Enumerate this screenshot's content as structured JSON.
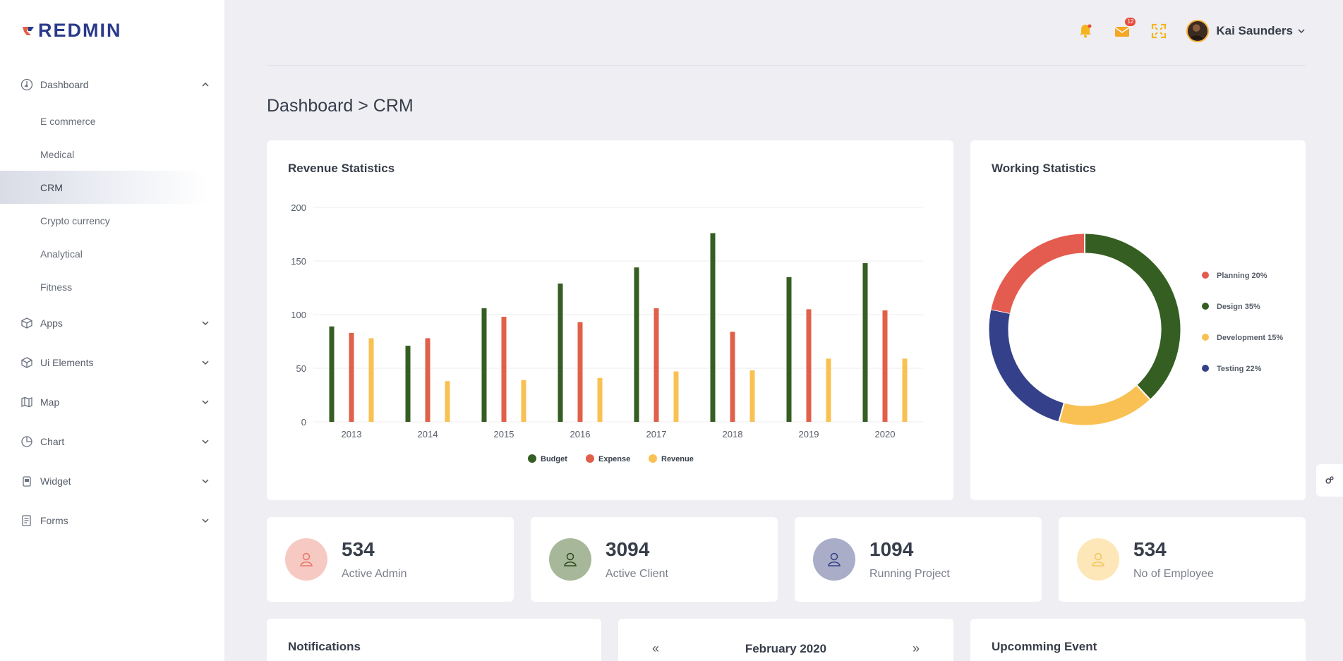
{
  "brand": {
    "name": "REDMIN"
  },
  "sidebar": {
    "dashboard": {
      "label": "Dashboard",
      "icon": "dashboard-icon"
    },
    "sub_items": [
      {
        "label": "E commerce"
      },
      {
        "label": "Medical"
      },
      {
        "label": "CRM",
        "active": true
      },
      {
        "label": "Crypto currency"
      },
      {
        "label": "Analytical"
      },
      {
        "label": "Fitness"
      }
    ],
    "items": [
      {
        "label": "Apps",
        "icon": "box-icon"
      },
      {
        "label": "Ui Elements",
        "icon": "cube-icon"
      },
      {
        "label": "Map",
        "icon": "map-icon"
      },
      {
        "label": "Chart",
        "icon": "pie-chart-icon"
      },
      {
        "label": "Widget",
        "icon": "widget-icon"
      },
      {
        "label": "Forms",
        "icon": "form-icon"
      }
    ]
  },
  "topbar": {
    "mail_badge": "12",
    "user_name": "Kai Saunders"
  },
  "page_title": "Dashboard > CRM",
  "revenue_card": {
    "title": "Revenue Statistics"
  },
  "working_card": {
    "title": "Working Statistics"
  },
  "stats": [
    {
      "value": "534",
      "label": "Active Admin",
      "color": "#e8766a",
      "bg": "#f7c9c3"
    },
    {
      "value": "3094",
      "label": "Active Client",
      "color": "#3d5a2a",
      "bg": "#a7b89a"
    },
    {
      "value": "1094",
      "label": "Running Project",
      "color": "#34418a",
      "bg": "#a9adc8"
    },
    {
      "value": "534",
      "label": "No of Employee",
      "color": "#f5c55c",
      "bg": "#fde7b8"
    }
  ],
  "bottom": {
    "notifications_title": "Notifications",
    "calendar_month": "February 2020",
    "calendar_prev": "«",
    "calendar_next": "»",
    "events_title": "Upcomming Event"
  },
  "chart_data": [
    {
      "type": "bar",
      "title": "Revenue Statistics",
      "categories": [
        "2013",
        "2014",
        "2015",
        "2016",
        "2017",
        "2018",
        "2019",
        "2020"
      ],
      "series": [
        {
          "name": "Budget",
          "color": "#355e22",
          "values": [
            89,
            71,
            106,
            129,
            144,
            176,
            135,
            148
          ]
        },
        {
          "name": "Expense",
          "color": "#e0604a",
          "values": [
            83,
            78,
            98,
            93,
            106,
            84,
            105,
            104
          ]
        },
        {
          "name": "Revenue",
          "color": "#f9c153",
          "values": [
            78,
            38,
            39,
            41,
            47,
            48,
            59,
            59
          ]
        }
      ],
      "y_ticks": [
        "0",
        "50",
        "100",
        "150",
        "200"
      ],
      "ylim": [
        0,
        200
      ],
      "legend": "bottom",
      "grid": true
    },
    {
      "type": "pie",
      "title": "Working Statistics",
      "slices": [
        {
          "label": "Planning 20%",
          "value": 20,
          "color": "#e45c4f"
        },
        {
          "label": "Design 35%",
          "value": 35,
          "color": "#355e22"
        },
        {
          "label": "Development 15%",
          "value": 15,
          "color": "#f9c153"
        },
        {
          "label": "Testing 22%",
          "value": 22,
          "color": "#34418a"
        }
      ],
      "legend": "right"
    }
  ]
}
